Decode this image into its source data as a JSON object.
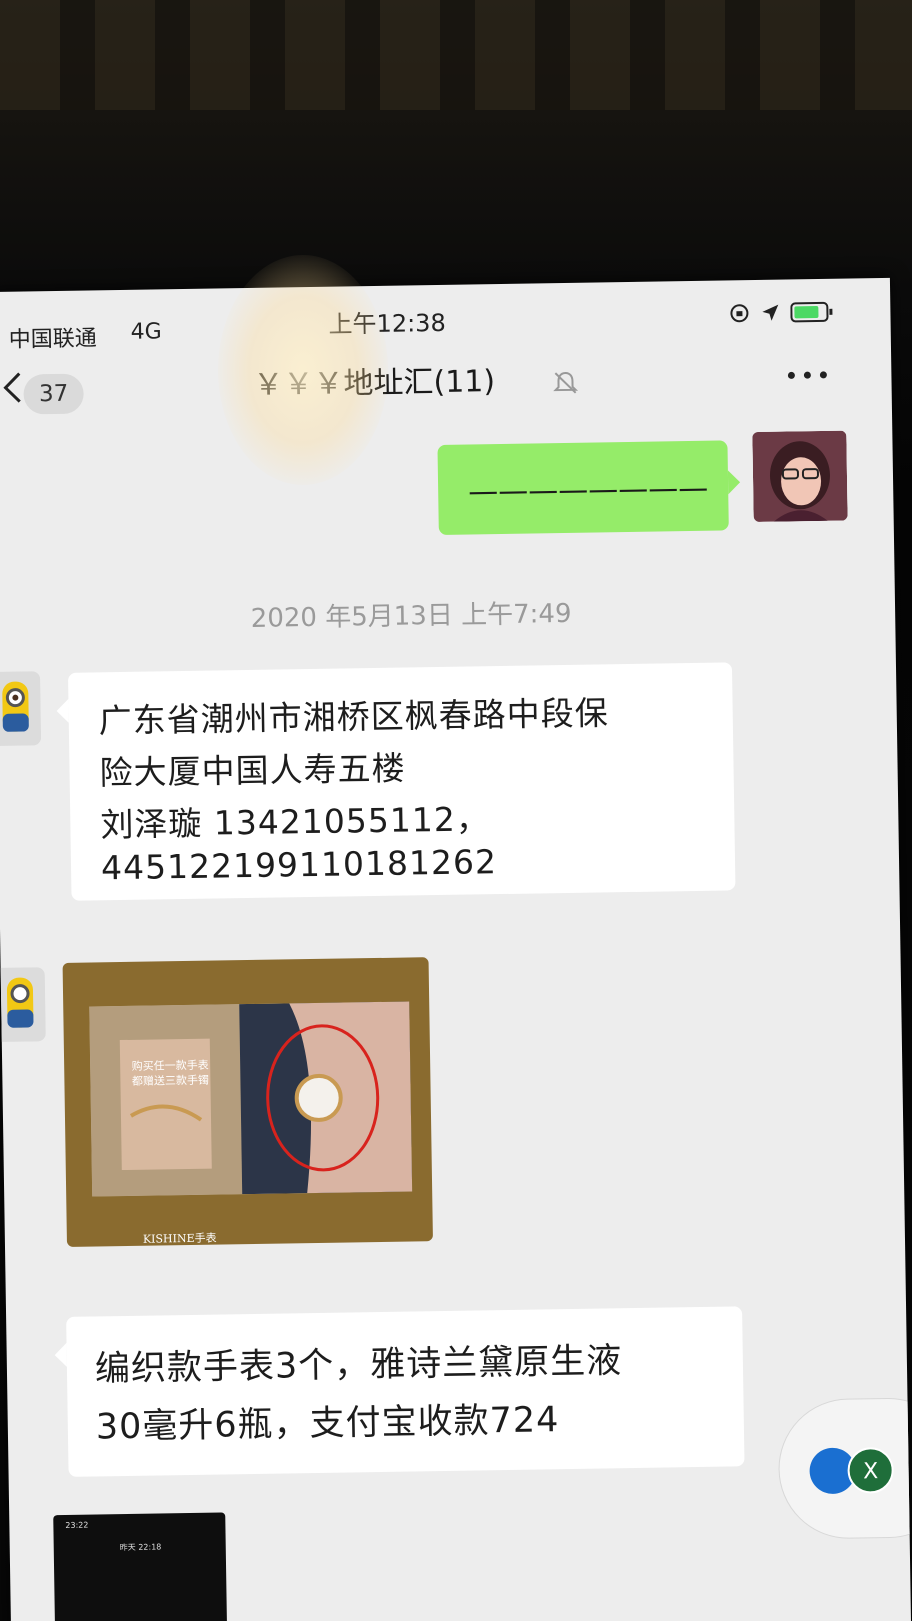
{
  "status_bar": {
    "carrier": "中国联通",
    "network": "4G",
    "time": "上午12:38"
  },
  "nav": {
    "unread_count": "37",
    "title": "￥￥￥地址汇(11)",
    "icons": [
      "back-icon",
      "mute-icon",
      "more-icon"
    ]
  },
  "messages": {
    "my_message": "————————",
    "timestamp": "2020 年5月13日 上午7:49",
    "address_lines": [
      "广东省潮州市湘桥区枫春路中段保",
      "险大厦中国人寿五楼",
      "刘泽璇  13421055112，",
      "445122199110181262"
    ],
    "image_promo": {
      "line1": "购买任一款手表",
      "line2": "都赠送三款手镯",
      "brand": "KISHINE手表"
    },
    "order_lines": [
      "编织款手表3个，雅诗兰黛原生液",
      "30毫升6瓶，支付宝收款724"
    ],
    "screenshot_thumb": {
      "time": "23:22",
      "title": "昨天 22:18"
    }
  },
  "floating_widget": {
    "icon_letter": "X"
  },
  "colors": {
    "my_bubble": "#95ec69",
    "their_bubble": "#ffffff",
    "chat_background": "#ededed"
  }
}
